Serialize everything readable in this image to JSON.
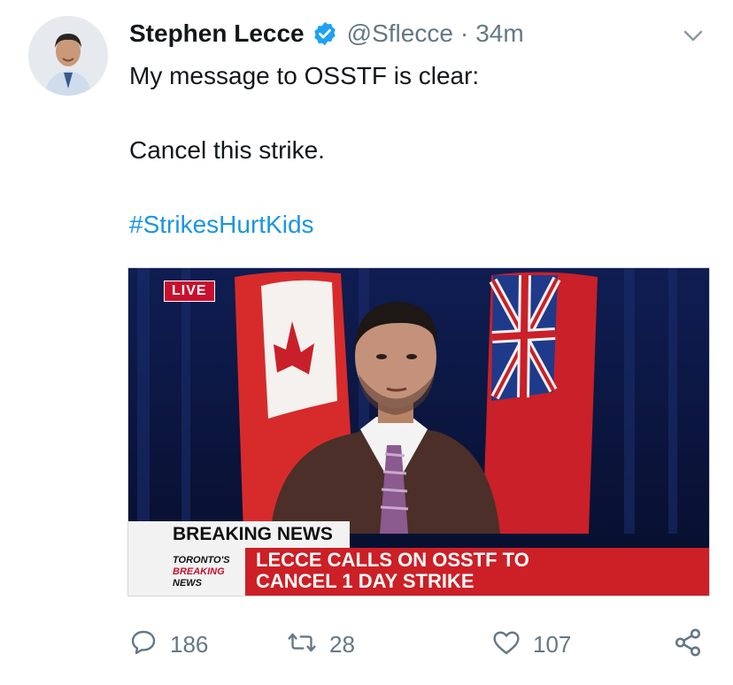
{
  "tweet": {
    "author": {
      "name": "Stephen Lecce",
      "handle": "@Sflecce",
      "time": "34m",
      "separator": "·"
    },
    "text_lines": [
      "My message to OSSTF is clear:",
      "Cancel this strike."
    ],
    "hashtag": "#StrikesHurtKids",
    "media": {
      "live_label": "LIVE",
      "breaking_label": "BREAKING NEWS",
      "logo_lines": [
        "TORONTO'S",
        "BREAKING",
        "NEWS"
      ],
      "headline_lines": [
        "LECCE CALLS ON OSSTF TO",
        "CANCEL 1 DAY STRIKE"
      ]
    },
    "stats": {
      "replies": "186",
      "retweets": "28",
      "likes": "107"
    }
  },
  "icons": [
    "verified-badge-icon",
    "chevron-down-icon",
    "reply-icon",
    "retweet-icon",
    "like-icon",
    "share-icon"
  ],
  "colors": {
    "link": "#1b95e0",
    "verified": "#1da1f2",
    "muted": "#657786",
    "breaking_red": "#cc1f26"
  }
}
